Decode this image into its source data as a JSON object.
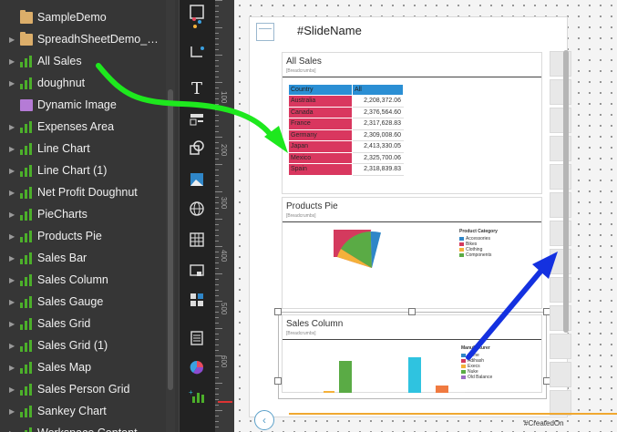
{
  "explorer": {
    "items": [
      {
        "label": "SampleDemo",
        "icon": "folder-icon",
        "expandable": false
      },
      {
        "label": "SpreadhSheetDemo_D...",
        "icon": "folder-icon",
        "expandable": true
      },
      {
        "label": "All Sales",
        "icon": "bar-chart-icon",
        "expandable": true
      },
      {
        "label": "doughnut",
        "icon": "bar-chart-icon",
        "expandable": true
      },
      {
        "label": "Dynamic Image",
        "icon": "image-icon",
        "expandable": false
      },
      {
        "label": "Expenses Area",
        "icon": "bar-chart-icon",
        "expandable": true
      },
      {
        "label": "Line Chart",
        "icon": "bar-chart-icon",
        "expandable": true
      },
      {
        "label": "Line Chart (1)",
        "icon": "bar-chart-icon",
        "expandable": true
      },
      {
        "label": "Net Profit Doughnut",
        "icon": "bar-chart-icon",
        "expandable": true
      },
      {
        "label": "PieCharts",
        "icon": "bar-chart-icon",
        "expandable": true
      },
      {
        "label": "Products Pie",
        "icon": "bar-chart-icon",
        "expandable": true
      },
      {
        "label": "Sales Bar",
        "icon": "bar-chart-icon",
        "expandable": true
      },
      {
        "label": "Sales Column",
        "icon": "bar-chart-icon",
        "expandable": true
      },
      {
        "label": "Sales Gauge",
        "icon": "bar-chart-icon",
        "expandable": true
      },
      {
        "label": "Sales Grid",
        "icon": "bar-chart-icon",
        "expandable": true
      },
      {
        "label": "Sales Grid (1)",
        "icon": "bar-chart-icon",
        "expandable": true
      },
      {
        "label": "Sales Map",
        "icon": "bar-chart-icon",
        "expandable": true
      },
      {
        "label": "Sales Person Grid",
        "icon": "bar-chart-icon",
        "expandable": true
      },
      {
        "label": "Sankey Chart",
        "icon": "bar-chart-icon",
        "expandable": true
      },
      {
        "label": "Workspace Content",
        "icon": "bar-chart-icon",
        "expandable": true
      }
    ]
  },
  "toolbar": {
    "tools": [
      "select-tool-icon",
      "sparkle-icon",
      "connector-icon",
      "text-icon",
      "picture-text-icon",
      "shapes-icon",
      "image-icon",
      "web-icon",
      "table-icon",
      "frame-icon",
      "grid-icon",
      "page-icon",
      "palette-icon",
      "chart-add-icon"
    ]
  },
  "ruler": {
    "marks": [
      "100",
      "200",
      "300",
      "400",
      "500",
      "600"
    ]
  },
  "slide": {
    "name": "#SlideName",
    "created_on": "#CreatedOn",
    "panels": {
      "all_sales": {
        "title": "All Sales",
        "breadcrumbs": "[Breadcrumbs]",
        "columns": [
          "Country",
          "All"
        ],
        "rows": [
          [
            "Australia",
            "2,208,372.06"
          ],
          [
            "Canada",
            "2,376,564.60"
          ],
          [
            "France",
            "2,317,628.83"
          ],
          [
            "Germany",
            "2,309,008.60"
          ],
          [
            "Japan",
            "2,413,330.05"
          ],
          [
            "Mexico",
            "2,325,700.06"
          ],
          [
            "Spain",
            "2,318,839.83"
          ]
        ]
      },
      "products_pie": {
        "title": "Products Pie",
        "breadcrumbs": "[Breadcrumbs]",
        "legend_title": "Product Category",
        "legend": [
          {
            "name": "Accessories",
            "color": "#2f86c8"
          },
          {
            "name": "Bikes",
            "color": "#d43a5e"
          },
          {
            "name": "Clothing",
            "color": "#f4b13a"
          },
          {
            "name": "Components",
            "color": "#5aab45"
          }
        ]
      },
      "sales_column": {
        "title": "Sales Column",
        "breadcrumbs": "[Breadcrumbs]",
        "legend_title": "Manufacturer",
        "legend": [
          {
            "name": "Acme",
            "color": "#2f86c8"
          },
          {
            "name": "Adihash",
            "color": "#d43a5e"
          },
          {
            "name": "Execs",
            "color": "#f4b13a"
          },
          {
            "name": "Nuke",
            "color": "#5aab45"
          },
          {
            "name": "Old Balance",
            "color": "#9b6bc4"
          }
        ]
      }
    }
  },
  "colors": {
    "annotation_green": "#1ee81e",
    "annotation_blue": "#1431e0",
    "accent_orange": "#f0a830"
  }
}
